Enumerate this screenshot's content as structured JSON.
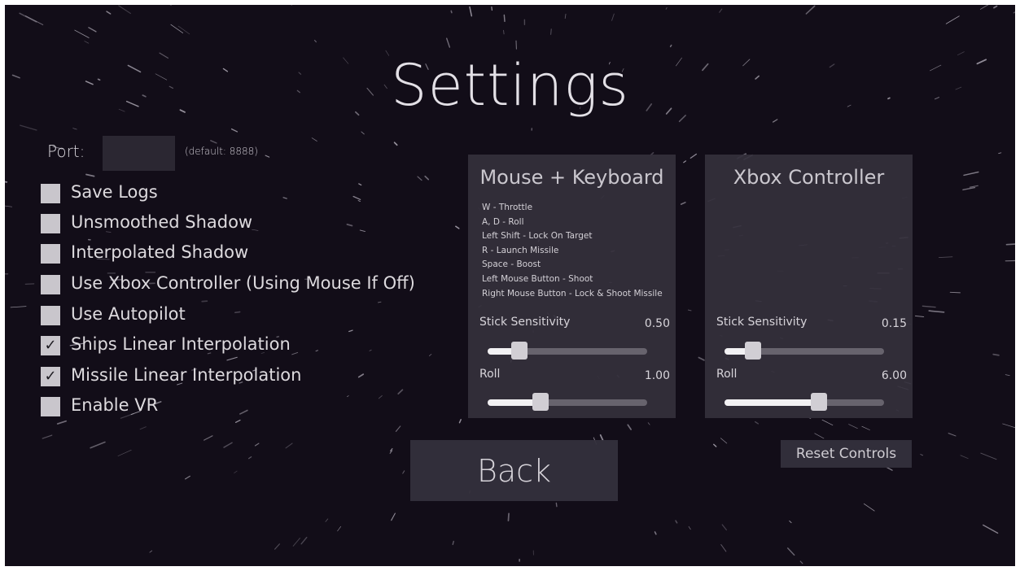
{
  "title": "Settings",
  "port": {
    "label": "Port:",
    "value": "",
    "hint": "(default: 8888)"
  },
  "checkboxes": [
    {
      "label": "Save Logs",
      "checked": false
    },
    {
      "label": "Unsmoothed Shadow",
      "checked": false
    },
    {
      "label": "Interpolated Shadow",
      "checked": false
    },
    {
      "label": "Use Xbox Controller (Using Mouse If Off)",
      "checked": false
    },
    {
      "label": "Use Autopilot",
      "checked": false
    },
    {
      "label": "Ships Linear Interpolation",
      "checked": true
    },
    {
      "label": "Missile Linear Interpolation",
      "checked": true
    },
    {
      "label": "Enable VR",
      "checked": false
    }
  ],
  "check_glyph": "✓",
  "mouse_keyboard": {
    "title": "Mouse + Keyboard",
    "controls": [
      "W - Throttle",
      "A, D - Roll",
      "Left Shift - Lock On Target",
      "R - Launch Missile",
      "Space - Boost",
      "Left Mouse Button - Shoot",
      "Right Mouse Button - Lock & Shoot Missile"
    ],
    "stick_sensitivity": {
      "label": "Stick Sensitivity",
      "value": "0.50",
      "fraction": 0.2
    },
    "roll": {
      "label": "Roll",
      "value": "1.00",
      "fraction": 0.33
    }
  },
  "xbox_controller": {
    "title": "Xbox Controller",
    "stick_sensitivity": {
      "label": "Stick Sensitivity",
      "value": "0.15",
      "fraction": 0.18
    },
    "roll": {
      "label": "Roll",
      "value": "6.00",
      "fraction": 0.59
    }
  },
  "back_button": "Back",
  "reset_button": "Reset Controls",
  "colors": {
    "background": "#120d18",
    "panel": "#34303c",
    "text": "#d9d6dc",
    "checkbox": "#c9c6cc"
  }
}
